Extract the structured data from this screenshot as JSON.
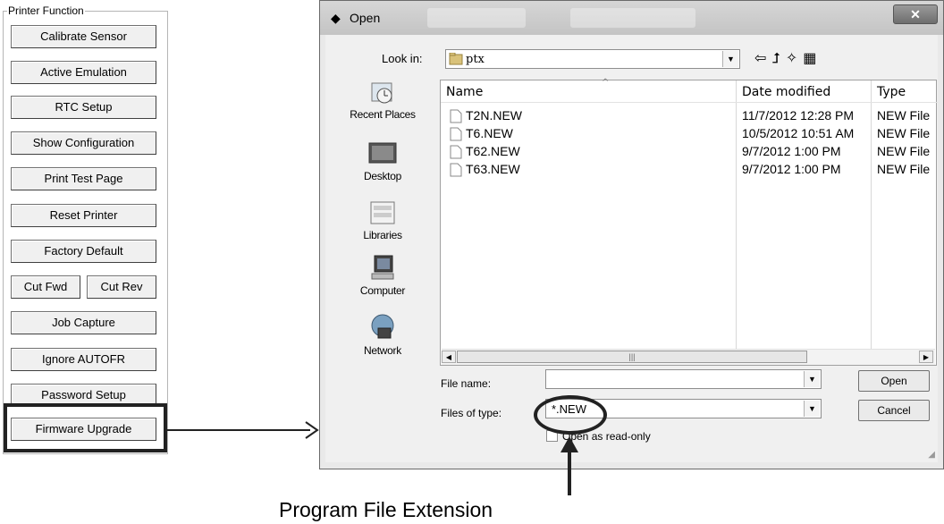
{
  "printer_function": {
    "title": "Printer Function",
    "buttons": [
      "Calibrate Sensor",
      "Active Emulation",
      "RTC Setup",
      "Show Configuration",
      "Print Test Page",
      "Reset Printer",
      "Factory Default",
      "Job Capture",
      "Ignore AUTOFR",
      "Password Setup",
      "Firmware Upgrade"
    ],
    "cut_fwd": "Cut Fwd",
    "cut_rev": "Cut Rev"
  },
  "dialog": {
    "title": "Open",
    "look_in_label": "Look in:",
    "look_in_value": "ptx",
    "places": [
      "Recent Places",
      "Desktop",
      "Libraries",
      "Computer",
      "Network"
    ],
    "columns": {
      "name": "Name",
      "date": "Date modified",
      "type": "Type"
    },
    "files": [
      {
        "name": "T2N.NEW",
        "date": "11/7/2012 12:28 PM",
        "type": "NEW File"
      },
      {
        "name": "T6.NEW",
        "date": "10/5/2012 10:51 AM",
        "type": "NEW File"
      },
      {
        "name": "T62.NEW",
        "date": "9/7/2012 1:00 PM",
        "type": "NEW File"
      },
      {
        "name": "T63.NEW",
        "date": "9/7/2012 1:00 PM",
        "type": "NEW File"
      }
    ],
    "file_name_label": "File name:",
    "file_name_value": "",
    "file_type_label": "Files of type:",
    "file_type_value": "*.NEW",
    "open_label": "Open",
    "cancel_label": "Cancel",
    "readonly_label": "Open as read-only"
  },
  "annotation": {
    "label": "Program File Extension"
  }
}
